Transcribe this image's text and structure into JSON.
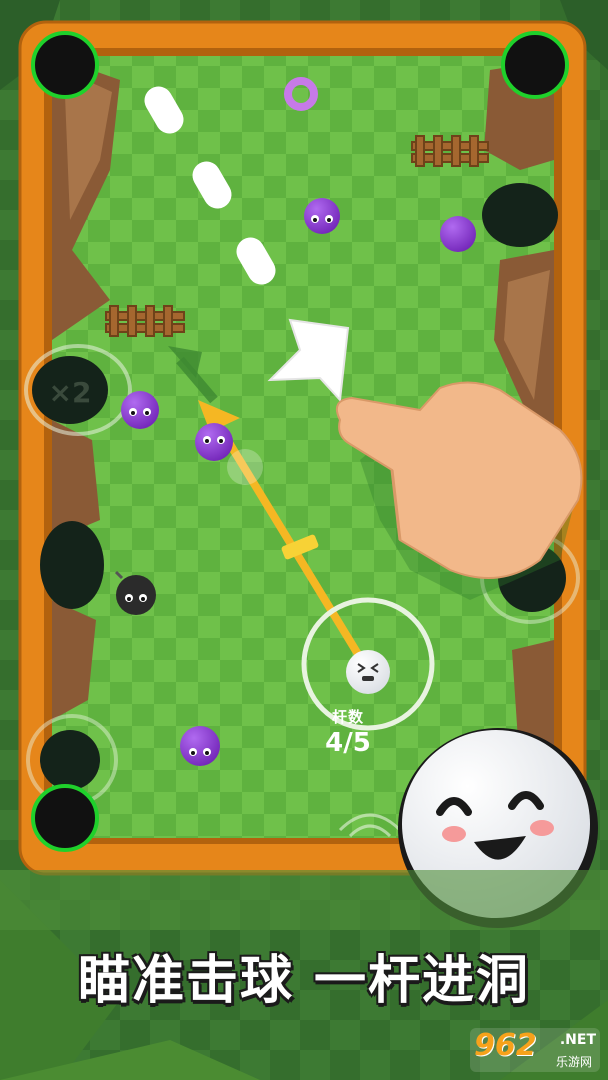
{
  "game": {
    "stroke_label": "杆数",
    "stroke_count": "4/5",
    "multiplier_left": "×2",
    "headline": "瞄准击球 一杆进洞"
  },
  "watermark": {
    "logo": "962",
    "suffix": ".NET",
    "subtitle": "乐游网"
  },
  "colors": {
    "frame": "#e6861a",
    "grass_light": "#6fc14a",
    "grass_dark": "#5cae3c",
    "enemy_ball": "#8e3ad4",
    "aim_line": "#f5b723",
    "hole_ring": "#1fd12b",
    "hand": "#f2b88a"
  },
  "icons": [
    "pocket-icon",
    "purple-ball-icon",
    "bomb-ball-icon",
    "white-ball-icon",
    "tap-hand-icon",
    "arrow-icon",
    "ring-icon"
  ]
}
